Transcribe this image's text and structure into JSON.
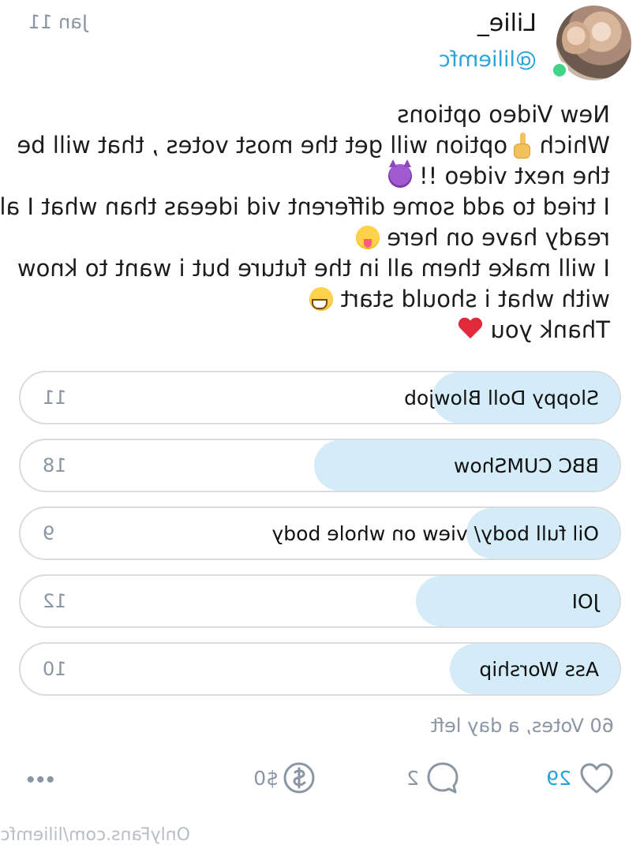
{
  "author": {
    "display_name": "Lilie_",
    "username": "@liliemfc",
    "date": "Jan 11"
  },
  "post": {
    "lines": [
      "New Video options",
      "Which ",
      " option will get the most votes , that will be",
      "the next video !! ",
      "I tried to add some different vid ideeas than what I al-",
      "ready have on here ",
      "I will make them all in the future but i want to know",
      "with what i should start ",
      "Thank you "
    ]
  },
  "poll": {
    "options": [
      {
        "label": "Sloppy Doll Blowjob",
        "votes": "11",
        "share": 0.1833
      },
      {
        "label": "BBC CUMShow",
        "votes": "18",
        "share": 0.3
      },
      {
        "label": "Oil full body/ view on whole body",
        "votes": "9",
        "share": 0.15
      },
      {
        "label": "JOI",
        "votes": "12",
        "share": 0.2
      },
      {
        "label": "Ass Worship",
        "votes": "10",
        "share": 0.1667
      }
    ],
    "summary": "60 Votes, a day left"
  },
  "actions": {
    "likes": "29",
    "comments": "2",
    "tips": "$0"
  },
  "watermark": "OnlyFans.com/liliemfc",
  "colors": {
    "accent": "#2aa3d9",
    "poll_fill": "#d4ebf8",
    "muted": "#8a96a3",
    "online": "#3fd48a"
  },
  "icons": {
    "like": "heart-icon",
    "comment": "comment-icon",
    "tip": "dollar-circle-icon",
    "more": "more-dots-icon"
  }
}
